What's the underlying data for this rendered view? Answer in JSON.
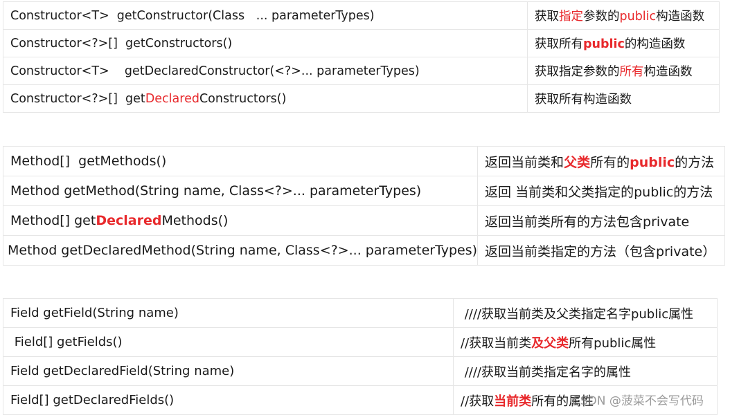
{
  "colors": {
    "highlight": "#e8292c",
    "grid": "#e6e6e6"
  },
  "tables": [
    {
      "rows": [
        {
          "left": [
            {
              "t": "Constructor<T>  getConstructor(Class   ... parameterTypes)"
            }
          ],
          "right": [
            {
              "t": "获取"
            },
            {
              "t": "指定",
              "c": "red"
            },
            {
              "t": "参数的"
            },
            {
              "t": "public",
              "c": "red"
            },
            {
              "t": "构造函数"
            }
          ]
        },
        {
          "left": [
            {
              "t": "Constructor<?>[]  getConstructors()"
            }
          ],
          "right": [
            {
              "t": "获取所有"
            },
            {
              "t": "public",
              "c": "red",
              "b": true
            },
            {
              "t": "的构造函数"
            }
          ]
        },
        {
          "left": [
            {
              "t": "Constructor<T>    getDeclaredConstructor(<?>... parameterTypes)"
            }
          ],
          "right": [
            {
              "t": "获取指定参数的"
            },
            {
              "t": "所有",
              "c": "red"
            },
            {
              "t": "构造函数"
            }
          ]
        },
        {
          "left": [
            {
              "t": "Constructor<?>[]  get"
            },
            {
              "t": "Declared",
              "c": "red"
            },
            {
              "t": "Constructors()"
            }
          ],
          "right": [
            {
              "t": "获取所有构造函数"
            }
          ]
        }
      ]
    },
    {
      "rows": [
        {
          "left": [
            {
              "t": "Method[]  getMethods()"
            }
          ],
          "right": [
            {
              "t": "返回当前类和"
            },
            {
              "t": "父类",
              "c": "red",
              "b": true
            },
            {
              "t": "所有的"
            },
            {
              "t": "public",
              "c": "red",
              "b": true
            },
            {
              "t": "的方法"
            }
          ]
        },
        {
          "left": [
            {
              "t": "Method getMethod(String name, Class<?>... parameterTypes)"
            }
          ],
          "right": [
            {
              "t": "返回 当前类和父类指定的public的方法"
            }
          ]
        },
        {
          "left": [
            {
              "t": "Method[] get"
            },
            {
              "t": "Declared",
              "c": "red",
              "b": true
            },
            {
              "t": "Methods()"
            }
          ],
          "right": [
            {
              "t": "返回当前类所有的方法包含private"
            }
          ]
        },
        {
          "left": [
            {
              "t": "Method getDeclaredMethod(String name, Class<?>... parameterTypes)"
            }
          ],
          "right": [
            {
              "t": "返回当前类指定的方法（包含private）"
            }
          ]
        }
      ]
    },
    {
      "rows": [
        {
          "left": [
            {
              "t": "Field getField(String name)"
            }
          ],
          "right": [
            {
              "t": " ////获取当前类及父类指定名字public属性"
            }
          ]
        },
        {
          "left": [
            {
              "t": " Field[] getFields()"
            }
          ],
          "right": [
            {
              "t": "//获取当前类"
            },
            {
              "t": "及父类",
              "c": "red",
              "b": true
            },
            {
              "t": "所有public属性"
            }
          ]
        },
        {
          "left": [
            {
              "t": "Field getDeclaredField(String name)"
            }
          ],
          "right": [
            {
              "t": " ////获取当前类指定名字的属性"
            }
          ]
        },
        {
          "left": [
            {
              "t": "Field[] getDeclaredFields()"
            }
          ],
          "right": [
            {
              "t": "//获取"
            },
            {
              "t": "当前类",
              "c": "red",
              "b": true
            },
            {
              "t": "所有的属性"
            }
          ]
        }
      ]
    }
  ],
  "watermark": "CSDN @菠菜不会写代码"
}
